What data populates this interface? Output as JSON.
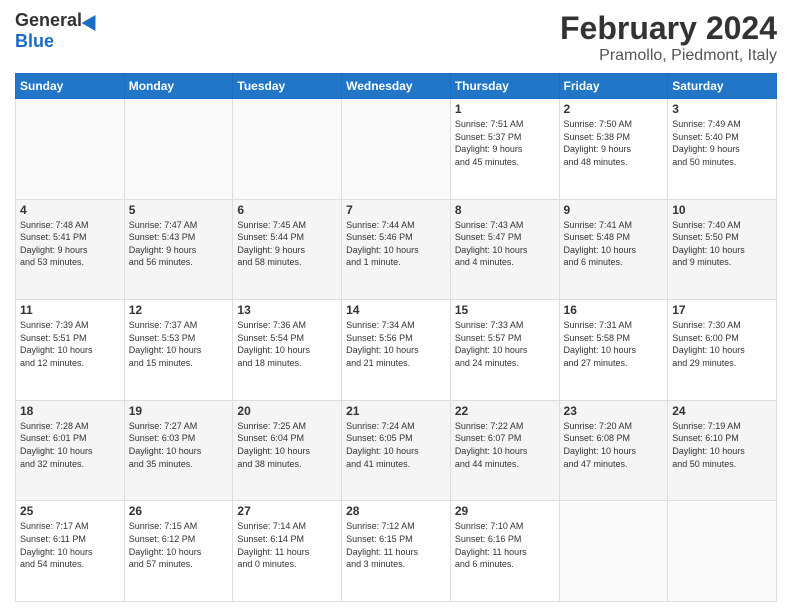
{
  "logo": {
    "general": "General",
    "blue": "Blue"
  },
  "title": {
    "month": "February 2024",
    "location": "Pramollo, Piedmont, Italy"
  },
  "weekdays": [
    "Sunday",
    "Monday",
    "Tuesday",
    "Wednesday",
    "Thursday",
    "Friday",
    "Saturday"
  ],
  "weeks": [
    [
      {
        "day": "",
        "info": ""
      },
      {
        "day": "",
        "info": ""
      },
      {
        "day": "",
        "info": ""
      },
      {
        "day": "",
        "info": ""
      },
      {
        "day": "1",
        "info": "Sunrise: 7:51 AM\nSunset: 5:37 PM\nDaylight: 9 hours\nand 45 minutes."
      },
      {
        "day": "2",
        "info": "Sunrise: 7:50 AM\nSunset: 5:38 PM\nDaylight: 9 hours\nand 48 minutes."
      },
      {
        "day": "3",
        "info": "Sunrise: 7:49 AM\nSunset: 5:40 PM\nDaylight: 9 hours\nand 50 minutes."
      }
    ],
    [
      {
        "day": "4",
        "info": "Sunrise: 7:48 AM\nSunset: 5:41 PM\nDaylight: 9 hours\nand 53 minutes."
      },
      {
        "day": "5",
        "info": "Sunrise: 7:47 AM\nSunset: 5:43 PM\nDaylight: 9 hours\nand 56 minutes."
      },
      {
        "day": "6",
        "info": "Sunrise: 7:45 AM\nSunset: 5:44 PM\nDaylight: 9 hours\nand 58 minutes."
      },
      {
        "day": "7",
        "info": "Sunrise: 7:44 AM\nSunset: 5:46 PM\nDaylight: 10 hours\nand 1 minute."
      },
      {
        "day": "8",
        "info": "Sunrise: 7:43 AM\nSunset: 5:47 PM\nDaylight: 10 hours\nand 4 minutes."
      },
      {
        "day": "9",
        "info": "Sunrise: 7:41 AM\nSunset: 5:48 PM\nDaylight: 10 hours\nand 6 minutes."
      },
      {
        "day": "10",
        "info": "Sunrise: 7:40 AM\nSunset: 5:50 PM\nDaylight: 10 hours\nand 9 minutes."
      }
    ],
    [
      {
        "day": "11",
        "info": "Sunrise: 7:39 AM\nSunset: 5:51 PM\nDaylight: 10 hours\nand 12 minutes."
      },
      {
        "day": "12",
        "info": "Sunrise: 7:37 AM\nSunset: 5:53 PM\nDaylight: 10 hours\nand 15 minutes."
      },
      {
        "day": "13",
        "info": "Sunrise: 7:36 AM\nSunset: 5:54 PM\nDaylight: 10 hours\nand 18 minutes."
      },
      {
        "day": "14",
        "info": "Sunrise: 7:34 AM\nSunset: 5:56 PM\nDaylight: 10 hours\nand 21 minutes."
      },
      {
        "day": "15",
        "info": "Sunrise: 7:33 AM\nSunset: 5:57 PM\nDaylight: 10 hours\nand 24 minutes."
      },
      {
        "day": "16",
        "info": "Sunrise: 7:31 AM\nSunset: 5:58 PM\nDaylight: 10 hours\nand 27 minutes."
      },
      {
        "day": "17",
        "info": "Sunrise: 7:30 AM\nSunset: 6:00 PM\nDaylight: 10 hours\nand 29 minutes."
      }
    ],
    [
      {
        "day": "18",
        "info": "Sunrise: 7:28 AM\nSunset: 6:01 PM\nDaylight: 10 hours\nand 32 minutes."
      },
      {
        "day": "19",
        "info": "Sunrise: 7:27 AM\nSunset: 6:03 PM\nDaylight: 10 hours\nand 35 minutes."
      },
      {
        "day": "20",
        "info": "Sunrise: 7:25 AM\nSunset: 6:04 PM\nDaylight: 10 hours\nand 38 minutes."
      },
      {
        "day": "21",
        "info": "Sunrise: 7:24 AM\nSunset: 6:05 PM\nDaylight: 10 hours\nand 41 minutes."
      },
      {
        "day": "22",
        "info": "Sunrise: 7:22 AM\nSunset: 6:07 PM\nDaylight: 10 hours\nand 44 minutes."
      },
      {
        "day": "23",
        "info": "Sunrise: 7:20 AM\nSunset: 6:08 PM\nDaylight: 10 hours\nand 47 minutes."
      },
      {
        "day": "24",
        "info": "Sunrise: 7:19 AM\nSunset: 6:10 PM\nDaylight: 10 hours\nand 50 minutes."
      }
    ],
    [
      {
        "day": "25",
        "info": "Sunrise: 7:17 AM\nSunset: 6:11 PM\nDaylight: 10 hours\nand 54 minutes."
      },
      {
        "day": "26",
        "info": "Sunrise: 7:15 AM\nSunset: 6:12 PM\nDaylight: 10 hours\nand 57 minutes."
      },
      {
        "day": "27",
        "info": "Sunrise: 7:14 AM\nSunset: 6:14 PM\nDaylight: 11 hours\nand 0 minutes."
      },
      {
        "day": "28",
        "info": "Sunrise: 7:12 AM\nSunset: 6:15 PM\nDaylight: 11 hours\nand 3 minutes."
      },
      {
        "day": "29",
        "info": "Sunrise: 7:10 AM\nSunset: 6:16 PM\nDaylight: 11 hours\nand 6 minutes."
      },
      {
        "day": "",
        "info": ""
      },
      {
        "day": "",
        "info": ""
      }
    ]
  ]
}
